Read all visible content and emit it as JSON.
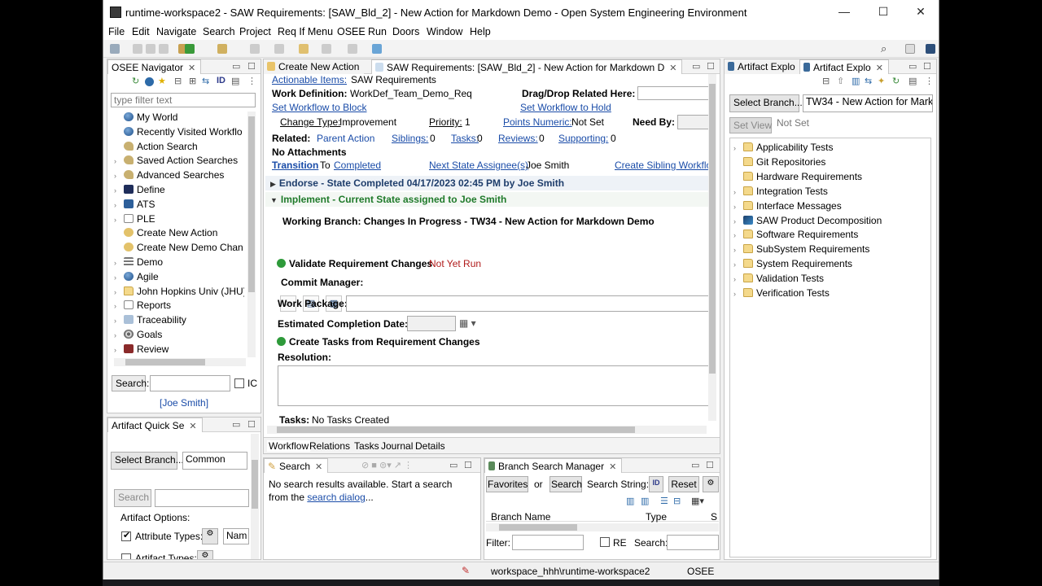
{
  "window": {
    "title": "runtime-workspace2 - SAW Requirements: [SAW_Bld_2] - New Action for Markdown Demo - Open System Engineering Environment",
    "controls": {
      "minimize": "—",
      "maximize": "☐",
      "close": "✕"
    }
  },
  "menu": [
    "File",
    "Edit",
    "Navigate",
    "Search",
    "Project",
    "Req If Menu",
    "OSEE",
    "Run",
    "Doors",
    "Window",
    "Help"
  ],
  "navigator": {
    "tab": "OSEE Navigator",
    "filter_placeholder": "type filter text",
    "items": [
      {
        "label": "My World",
        "icon": "globe-icon",
        "expandable": false
      },
      {
        "label": "Recently Visited Workflo",
        "icon": "globe-icon",
        "expandable": false
      },
      {
        "label": "Action Search",
        "icon": "search-icon",
        "expandable": false
      },
      {
        "label": "Saved Action Searches",
        "icon": "search-icon",
        "expandable": true
      },
      {
        "label": "Advanced Searches",
        "icon": "search-icon",
        "expandable": true
      },
      {
        "label": "Define",
        "icon": "define-icon",
        "expandable": true
      },
      {
        "label": "ATS",
        "icon": "ats-icon",
        "expandable": true
      },
      {
        "label": "PLE",
        "icon": "doc-icon",
        "expandable": true
      },
      {
        "label": "Create New Action",
        "icon": "action-icon",
        "expandable": false
      },
      {
        "label": "Create New Demo Chan",
        "icon": "action-icon",
        "expandable": false
      },
      {
        "label": "Demo",
        "icon": "list-icon",
        "expandable": true
      },
      {
        "label": "Agile",
        "icon": "globe-icon",
        "expandable": true
      },
      {
        "label": "John Hopkins Univ (JHU)",
        "icon": "folder-icon",
        "expandable": true
      },
      {
        "label": "Reports",
        "icon": "doc-icon",
        "expandable": true
      },
      {
        "label": "Traceability",
        "icon": "trace-icon",
        "expandable": true
      },
      {
        "label": "Goals",
        "icon": "goal-icon",
        "expandable": true
      },
      {
        "label": "Review",
        "icon": "review-icon",
        "expandable": true
      }
    ],
    "search_label": "Search:",
    "search_value": "",
    "ic_label": "IC",
    "user": "[Joe Smith]"
  },
  "quick_search": {
    "tab": "Artifact Quick Se",
    "select_branch": "Select Branch...",
    "branch_value": "Common",
    "search_button": "Search",
    "options_label": "Artifact Options:",
    "attribute_types": "Attribute Types:",
    "attribute_value": "Nam",
    "artifact_types": "Artifact Types:"
  },
  "editor": {
    "tab_create": "Create New Action",
    "tab_saw": "SAW Requirements: [SAW_Bld_2] - New Action for Markdown D",
    "actionable_items_link": "Actionable Items:",
    "actionable_items_value": "SAW Requirements",
    "work_def_label": "Work Definition:",
    "work_def_value": "WorkDef_Team_Demo_Req",
    "dragdrop_label": "Drag/Drop Related Here:",
    "set_workflow_block": "Set Workflow to Block",
    "set_workflow_hold": "Set Workflow to Hold",
    "change_type_label": "Change Type:",
    "change_type_value": "Improvement",
    "priority_label": "Priority:",
    "priority_value": "1",
    "points_label": "Points Numeric:",
    "points_value": "Not Set",
    "need_by_label": "Need By:",
    "related_label": "Related:",
    "parent_action": "Parent Action",
    "siblings_label": "Siblings:",
    "siblings_value": "0",
    "tasks_label": "Tasks:",
    "tasks_value": "0",
    "reviews_label": "Reviews:",
    "reviews_value": "0",
    "supporting_label": "Supporting:",
    "supporting_value": "0",
    "attachments": "No Attachments",
    "transition_link": "Transition",
    "to_text": "To",
    "completed_link": "Completed",
    "next_state_link": "Next State Assignee(s)",
    "next_state_value": "Joe Smith",
    "create_sibling": "Create Sibling Workflo",
    "endorse_section": "Endorse - State Completed 04/17/2023 02:45 PM by Joe Smith",
    "implement_section": "Implement - Current State assigned to Joe Smith",
    "working_branch": "Working Branch: Changes In Progress - TW34 - New Action for Markdown Demo",
    "validate_label": "Validate Requirement Changes",
    "validate_status": "Not Yet Run",
    "commit_manager": "Commit Manager:",
    "work_package": "Work Package:",
    "est_completion": "Estimated Completion Date:",
    "create_tasks": "Create Tasks from Requirement Changes",
    "resolution": "Resolution:",
    "tasks_bottom_label": "Tasks:",
    "tasks_bottom_value": "No Tasks Created",
    "bottom_tabs": [
      "Workflow",
      "Relations",
      "Tasks",
      "Journal",
      "Details"
    ]
  },
  "search_view": {
    "tab": "Search",
    "message": "No search results available. Start a search from the",
    "link": "search dialog",
    "ellipsis": "..."
  },
  "branch_manager": {
    "tab": "Branch Search Manager",
    "favorites": "Favorites",
    "or": "or",
    "search": "Search",
    "search_string": "Search String:",
    "id_badge": "ID",
    "reset": "Reset",
    "col_branch": "Branch Name",
    "col_type": "Type",
    "col_s": "S",
    "filter": "Filter:",
    "re": "RE",
    "search_label": "Search:"
  },
  "explorer": {
    "tab1": "Artifact Explo",
    "tab2": "Artifact Explo",
    "select_branch": "Select Branch...",
    "branch_value": "TW34 - New Action for Marko",
    "set_view": "Set View",
    "not_set": "Not Set",
    "items": [
      {
        "label": "Applicability Tests",
        "icon": "folder-icon",
        "expandable": true
      },
      {
        "label": "Git Repositories",
        "icon": "folder-icon",
        "expandable": false
      },
      {
        "label": "Hardware Requirements",
        "icon": "folder-icon",
        "expandable": false
      },
      {
        "label": "Integration Tests",
        "icon": "folder-icon",
        "expandable": true
      },
      {
        "label": "Interface Messages",
        "icon": "folder-icon",
        "expandable": true
      },
      {
        "label": "SAW Product Decomposition",
        "icon": "product-icon",
        "expandable": true
      },
      {
        "label": "Software Requirements",
        "icon": "folder-icon",
        "expandable": true
      },
      {
        "label": "SubSystem Requirements",
        "icon": "folder-icon",
        "expandable": true
      },
      {
        "label": "System Requirements",
        "icon": "folder-icon",
        "expandable": true
      },
      {
        "label": "Validation Tests",
        "icon": "folder-icon",
        "expandable": true
      },
      {
        "label": "Verification Tests",
        "icon": "folder-icon",
        "expandable": true
      }
    ]
  },
  "status": {
    "workspace": "workspace_hhh\\runtime-workspace2",
    "app": "OSEE"
  }
}
